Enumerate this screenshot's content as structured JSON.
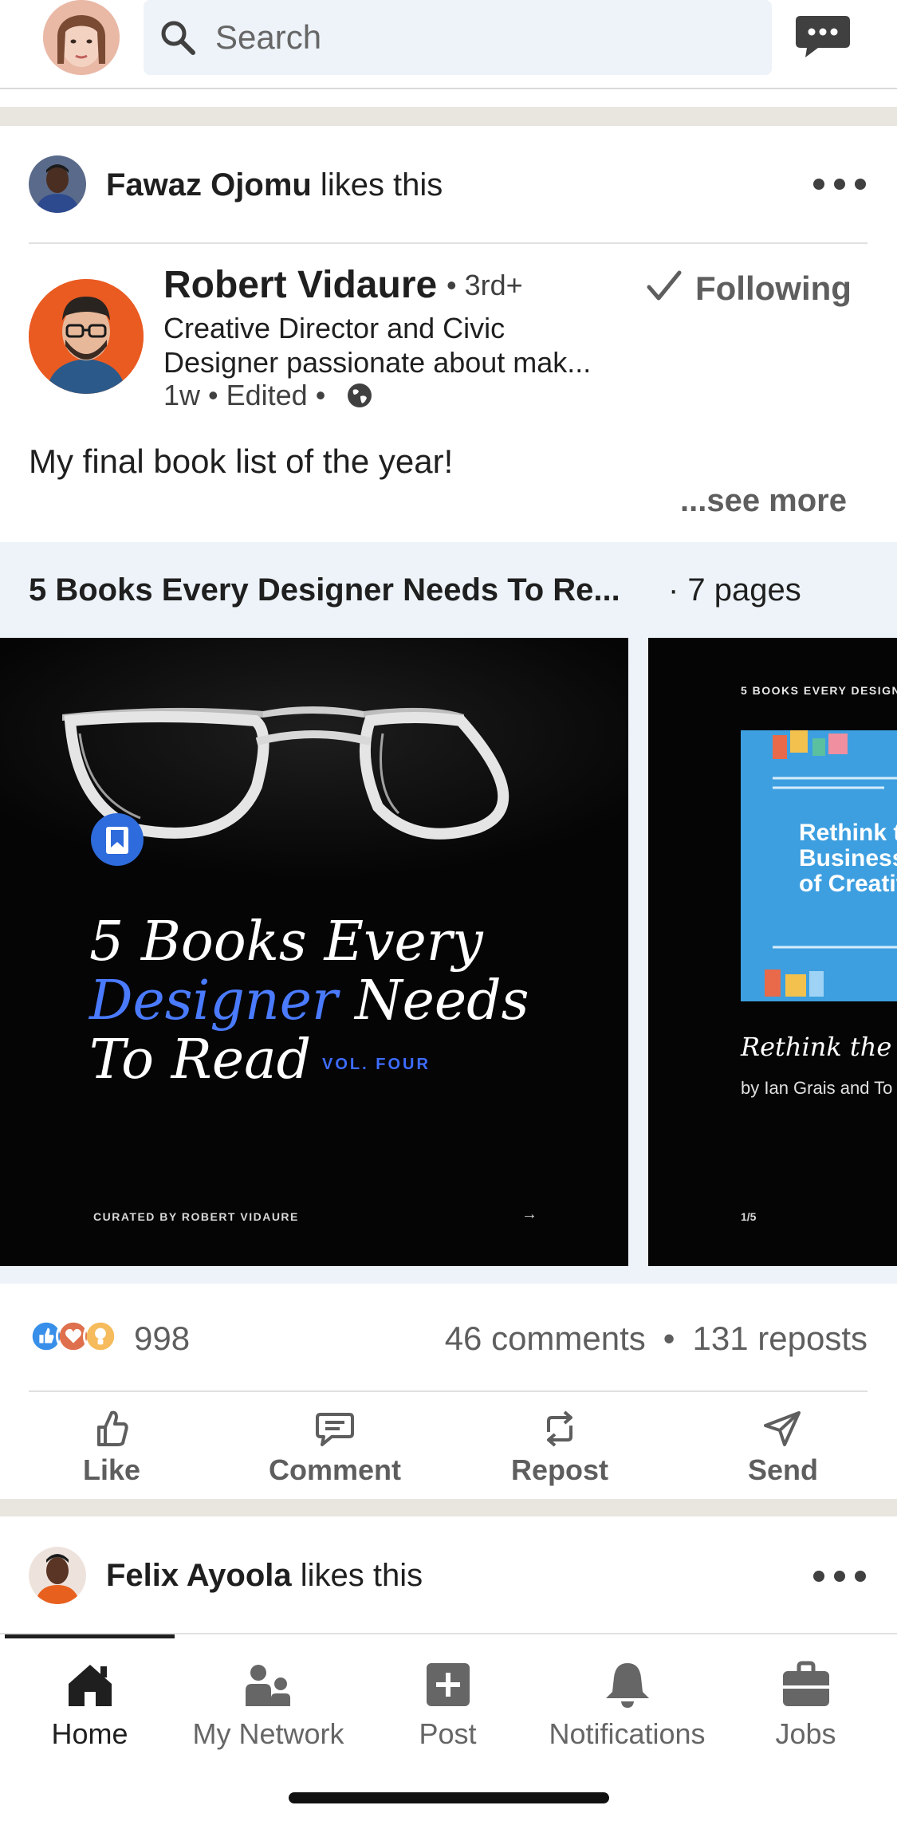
{
  "search": {
    "placeholder": "Search"
  },
  "post": {
    "social": {
      "name": "Fawaz Ojomu",
      "action": " likes this"
    },
    "author": {
      "name": "Robert Vidaure",
      "degree": "• 3rd+",
      "headline_line1": "Creative Director and Civic",
      "headline_line2": "Designer passionate about mak...",
      "meta": "1w • Edited •",
      "follow_label": "Following"
    },
    "text": "My final book list of the year!",
    "see_more": "...see more",
    "document": {
      "title": "5 Books Every Designer Needs To Re...",
      "pages": "· 7 pages",
      "slide1": {
        "line1": "5 Books Every",
        "line2_blue": "Designer",
        "line2_rest": " Needs",
        "line3": "To Read",
        "volume": "VOL. FOUR",
        "curated": "CURATED BY ROBERT VIDAURE",
        "arrow": "→"
      },
      "slide2": {
        "label": "5 BOOKS EVERY DESIGN",
        "book_line1": "Rethink th",
        "book_line2": "Business",
        "book_line3": "of Creativ",
        "caption": "Rethink the B",
        "byline": "by Ian Grais and To",
        "page": "1/5"
      }
    },
    "reactions": {
      "count": "998",
      "comments": "46 comments",
      "separator": "•",
      "reposts": "131 reposts"
    },
    "actions": {
      "like": "Like",
      "comment": "Comment",
      "repost": "Repost",
      "send": "Send"
    }
  },
  "next_post": {
    "name": "Felix Ayoola",
    "action": " likes this"
  },
  "nav": {
    "home": "Home",
    "network": "My Network",
    "post": "Post",
    "notifications": "Notifications",
    "jobs": "Jobs"
  },
  "colors": {
    "accent": "#0a66c2",
    "badge_blue": "#2e6bdc",
    "separator": "#e8e6df"
  }
}
